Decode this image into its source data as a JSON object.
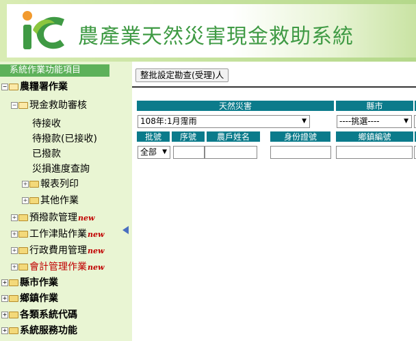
{
  "header": {
    "title": "農產業天然災害現金救助系統",
    "logo_colors": {
      "orange": "#f29a2e",
      "green": "#3f9a44",
      "light_green": "#8cc63f"
    }
  },
  "sidebar": {
    "title": "系統作業功能項目",
    "items": [
      {
        "label": "農糧署作業",
        "bold": true
      },
      {
        "label": "現金救助審核"
      },
      {
        "label": "待接收"
      },
      {
        "label": "待撥款(已接收)"
      },
      {
        "label": "已撥款"
      },
      {
        "label": "災損進度查詢"
      },
      {
        "label": "報表列印"
      },
      {
        "label": "其他作業"
      },
      {
        "label": "預撥款管理",
        "tag": "new"
      },
      {
        "label": "工作津貼作業",
        "tag": "new"
      },
      {
        "label": "行政費用管理",
        "tag": "new"
      },
      {
        "label": "會計管理作業",
        "tag": "new",
        "highlight": true
      },
      {
        "label": "縣市作業",
        "bold": true
      },
      {
        "label": "鄉鎮作業",
        "bold": true
      },
      {
        "label": "各類系統代碼",
        "bold": true
      },
      {
        "label": "系統服務功能",
        "bold": true
      }
    ]
  },
  "main": {
    "batch_button": "整批設定勘查(受理)人",
    "table": {
      "headers_row1": [
        "天然災害",
        "縣市"
      ],
      "disaster_selected": "108年:1月霪雨",
      "county_selected": "----挑選----",
      "headers_row2": [
        "批號",
        "序號",
        "農戶姓名",
        "身份證號",
        "鄉鎮編號"
      ],
      "batch_selected": "全部"
    }
  },
  "colors": {
    "sidebar_bg": "#e9f5d3",
    "sidebar_title_bg": "#5db15a",
    "table_header_bg": "#0b7b8b",
    "title_green": "#3f9a44"
  }
}
